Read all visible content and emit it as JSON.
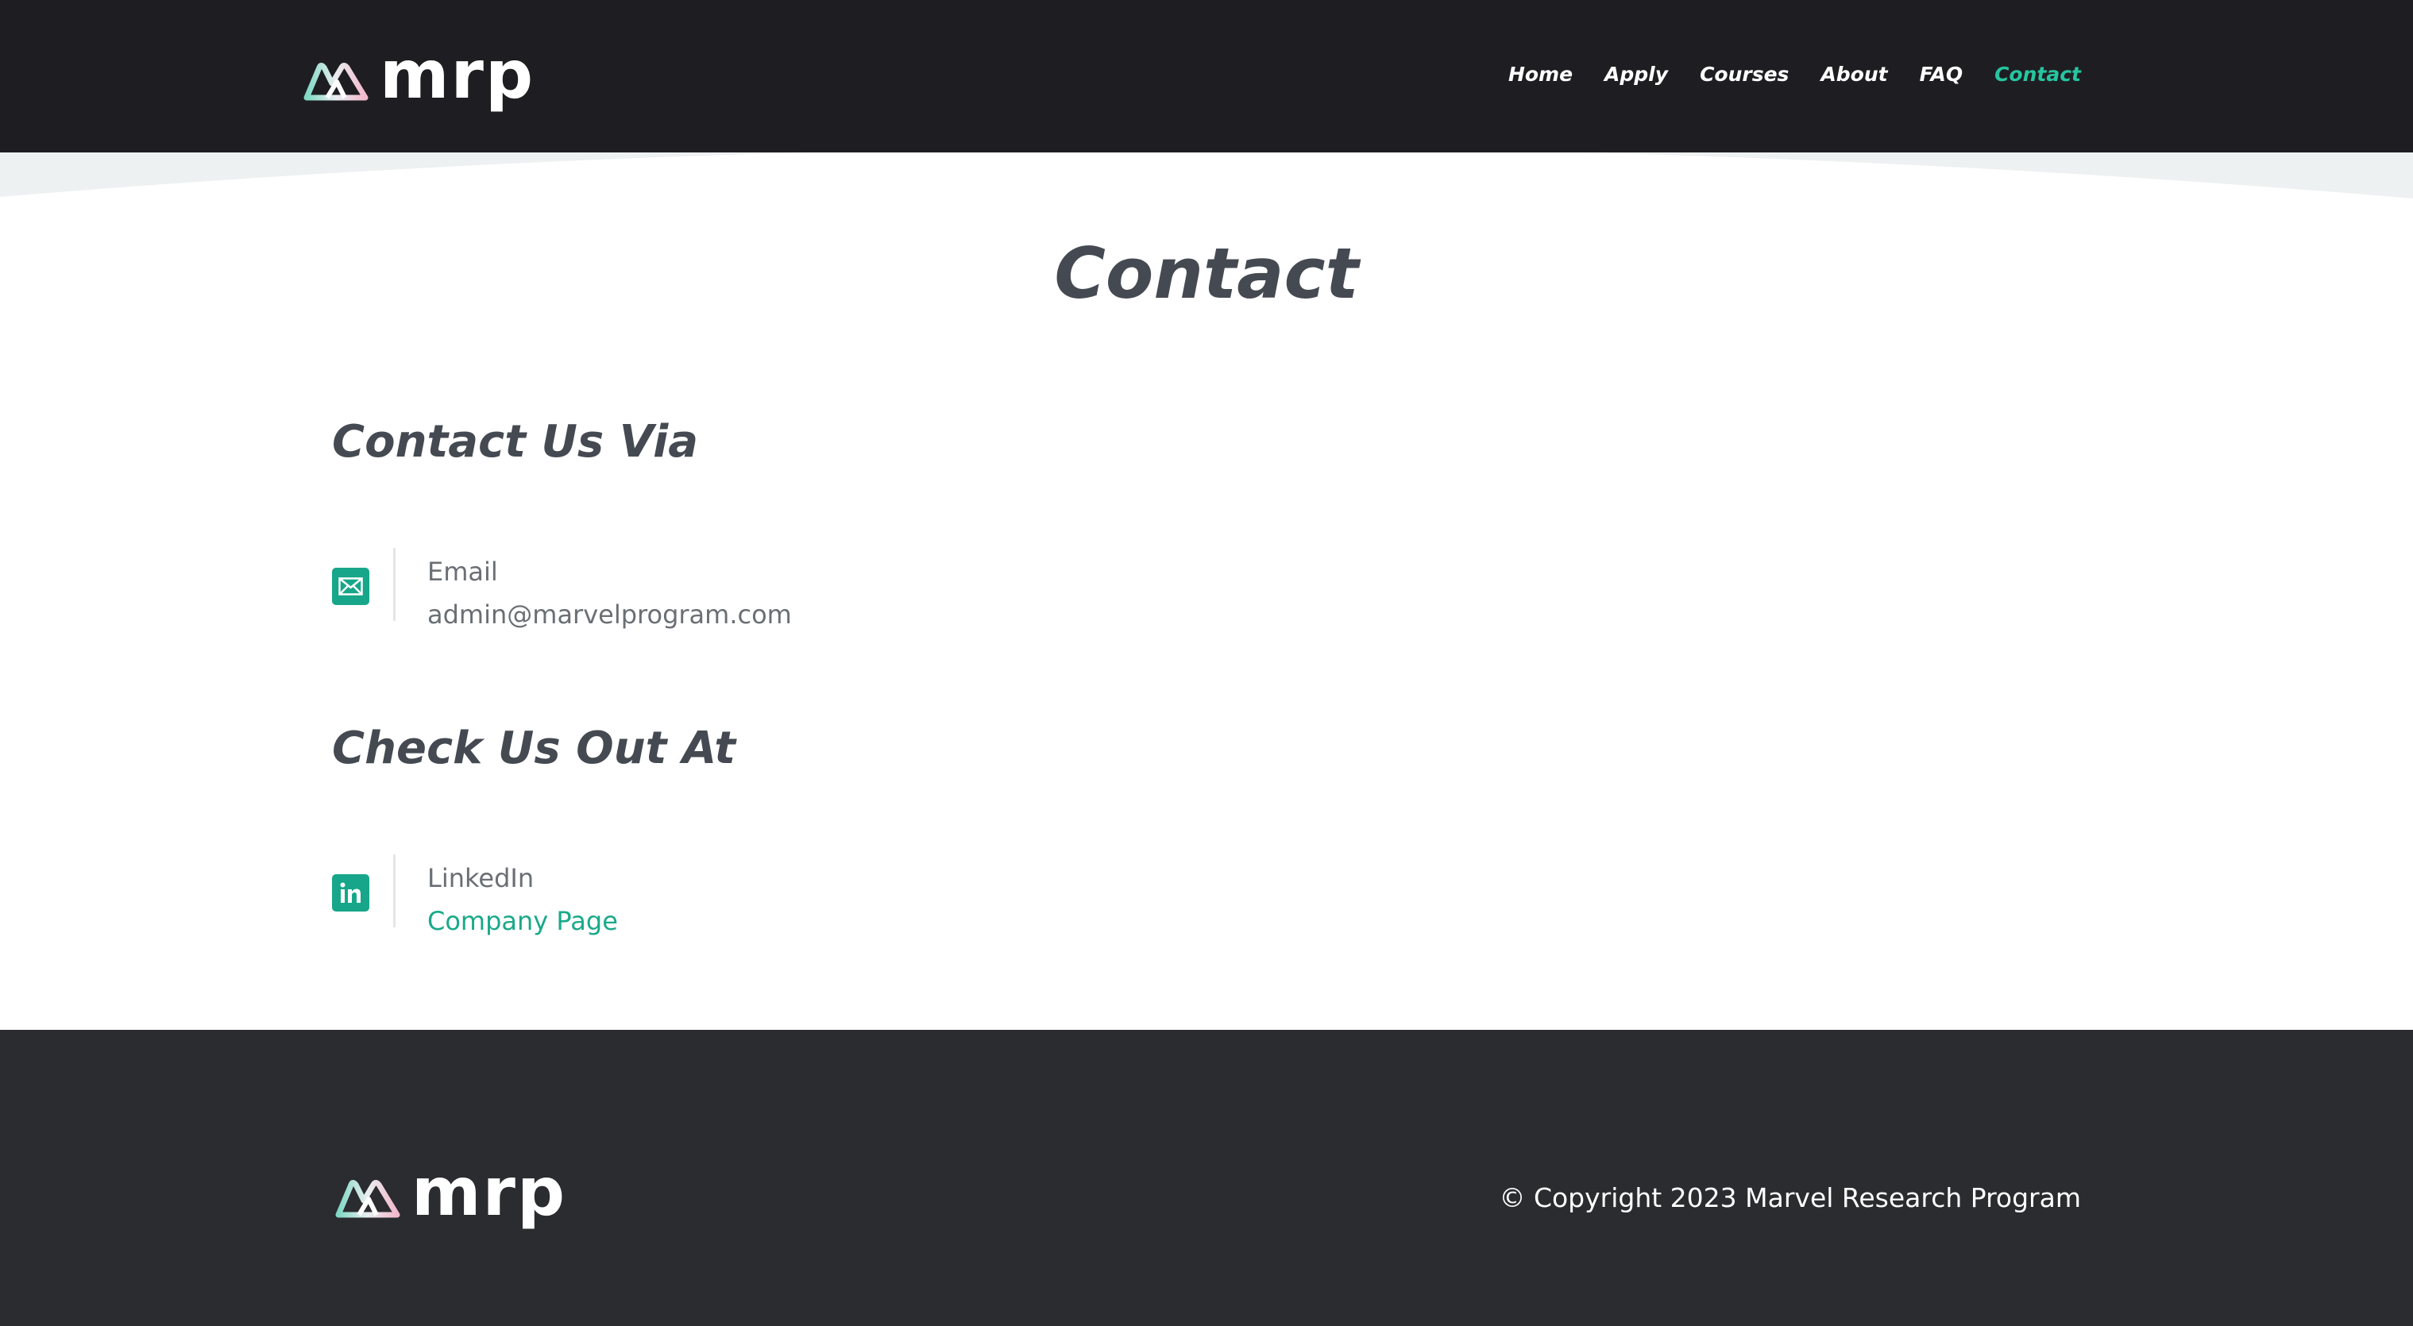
{
  "header": {
    "logo_text": "mrp",
    "nav": [
      {
        "label": "Home"
      },
      {
        "label": "Apply"
      },
      {
        "label": "Courses"
      },
      {
        "label": "About"
      },
      {
        "label": "FAQ"
      },
      {
        "label": "Contact",
        "active": true
      }
    ]
  },
  "main": {
    "title": "Contact",
    "contact_section": {
      "title": "Contact Us Via",
      "items": [
        {
          "label": "Email",
          "value": "admin@marvelprogram.com",
          "icon": "envelope-icon"
        }
      ]
    },
    "social_section": {
      "title": "Check Us Out At",
      "items": [
        {
          "label": "LinkedIn",
          "value": "Company Page",
          "icon": "linkedin-icon"
        }
      ]
    }
  },
  "footer": {
    "logo_text": "mrp",
    "copyright": "© Copyright 2023 Marvel Research Program"
  },
  "colors": {
    "header_bg": "#1e1e22",
    "footer_bg": "#2b2c30",
    "accent": "#26c5a0",
    "icon_bg": "#17a689",
    "heading": "#454a52",
    "body_text": "#6a6f75"
  }
}
